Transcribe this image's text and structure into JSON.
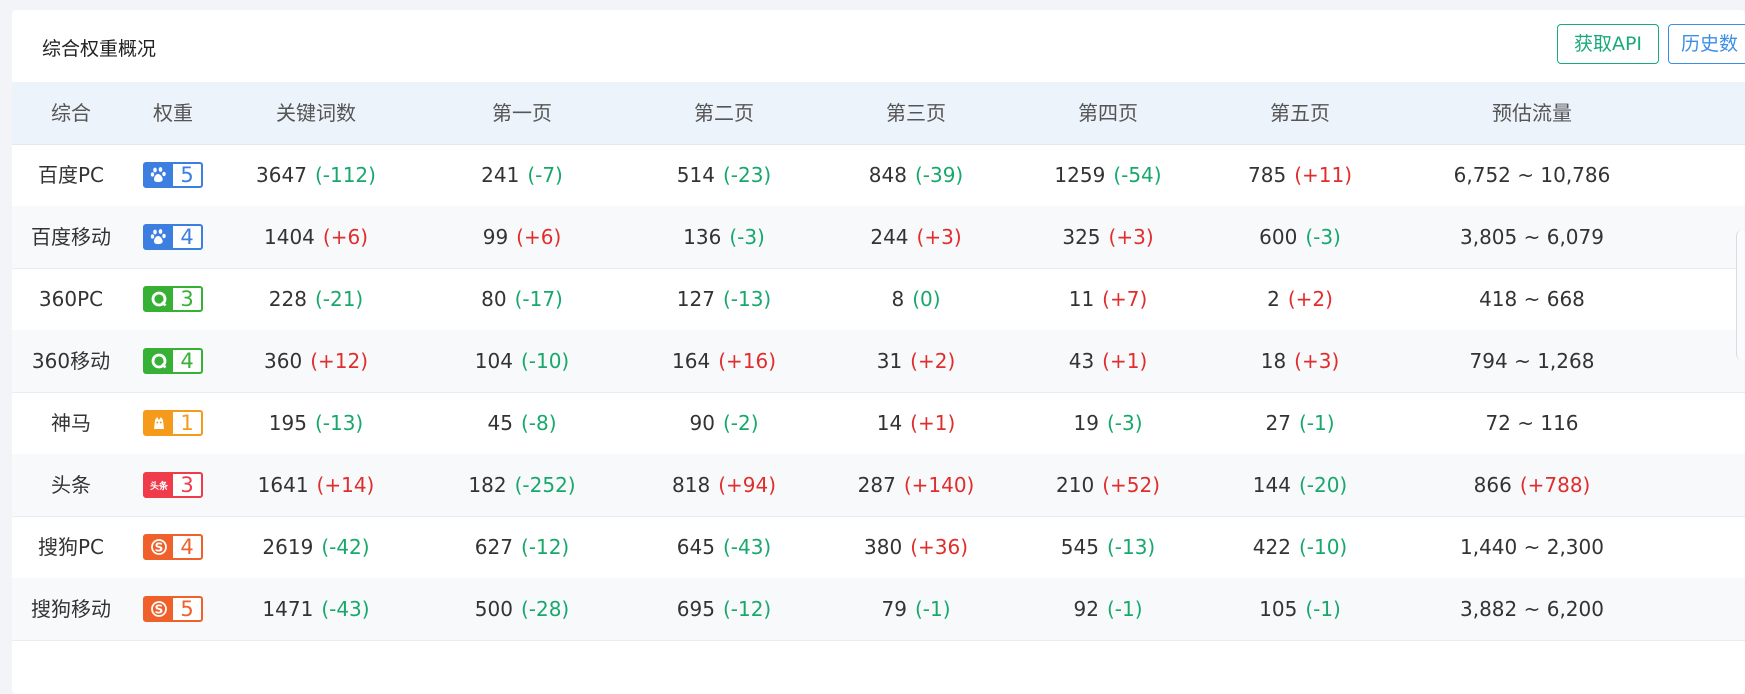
{
  "title": "综合权重概况",
  "buttons": {
    "api": "获取API",
    "history": "历史数"
  },
  "headers": [
    "综合",
    "权重",
    "关键词数",
    "第一页",
    "第二页",
    "第三页",
    "第四页",
    "第五页",
    "预估流量"
  ],
  "colors": {
    "up": "#e02d2d",
    "down": "#18a86c",
    "api_button": "#19a97b",
    "history_button": "#3c8ee8",
    "header_bg": "#edf3fb"
  },
  "rows": [
    {
      "name": "百度PC",
      "icon": "baidu-icon",
      "icon_color": "#3d7fe0",
      "weight": "5",
      "kw": [
        "3647",
        "(-112)"
      ],
      "p1": [
        "241",
        "(-7)"
      ],
      "p2": [
        "514",
        "(-23)"
      ],
      "p3": [
        "848",
        "(-39)"
      ],
      "p4": [
        "1259",
        "(-54)"
      ],
      "p5": [
        "785",
        "(+11)"
      ],
      "flow": [
        "6,752 ~ 10,786",
        ""
      ]
    },
    {
      "name": "百度移动",
      "icon": "baidu-icon",
      "icon_color": "#3d7fe0",
      "weight": "4",
      "kw": [
        "1404",
        "(+6)"
      ],
      "p1": [
        "99",
        "(+6)"
      ],
      "p2": [
        "136",
        "(-3)"
      ],
      "p3": [
        "244",
        "(+3)"
      ],
      "p4": [
        "325",
        "(+3)"
      ],
      "p5": [
        "600",
        "(-3)"
      ],
      "flow": [
        "3,805 ~ 6,079",
        ""
      ]
    },
    {
      "name": "360PC",
      "icon": "360-icon",
      "icon_color": "#36b136",
      "weight": "3",
      "kw": [
        "228",
        "(-21)"
      ],
      "p1": [
        "80",
        "(-17)"
      ],
      "p2": [
        "127",
        "(-13)"
      ],
      "p3": [
        "8",
        "(0)"
      ],
      "p4": [
        "11",
        "(+7)"
      ],
      "p5": [
        "2",
        "(+2)"
      ],
      "flow": [
        "418 ~ 668",
        ""
      ]
    },
    {
      "name": "360移动",
      "icon": "360-icon",
      "icon_color": "#36b136",
      "weight": "4",
      "kw": [
        "360",
        "(+12)"
      ],
      "p1": [
        "104",
        "(-10)"
      ],
      "p2": [
        "164",
        "(+16)"
      ],
      "p3": [
        "31",
        "(+2)"
      ],
      "p4": [
        "43",
        "(+1)"
      ],
      "p5": [
        "18",
        "(+3)"
      ],
      "flow": [
        "794 ~ 1,268",
        ""
      ]
    },
    {
      "name": "神马",
      "icon": "shenma-icon",
      "icon_color": "#f59a1b",
      "weight": "1",
      "kw": [
        "195",
        "(-13)"
      ],
      "p1": [
        "45",
        "(-8)"
      ],
      "p2": [
        "90",
        "(-2)"
      ],
      "p3": [
        "14",
        "(+1)"
      ],
      "p4": [
        "19",
        "(-3)"
      ],
      "p5": [
        "27",
        "(-1)"
      ],
      "flow": [
        "72 ~ 116",
        ""
      ]
    },
    {
      "name": "头条",
      "icon": "toutiao-icon",
      "icon_color": "#ef3b4a",
      "weight": "3",
      "kw": [
        "1641",
        "(+14)"
      ],
      "p1": [
        "182",
        "(-252)"
      ],
      "p2": [
        "818",
        "(+94)"
      ],
      "p3": [
        "287",
        "(+140)"
      ],
      "p4": [
        "210",
        "(+52)"
      ],
      "p5": [
        "144",
        "(-20)"
      ],
      "flow": [
        "866",
        "(+788)"
      ]
    },
    {
      "name": "搜狗PC",
      "icon": "sogou-icon",
      "icon_color": "#f0602a",
      "weight": "4",
      "kw": [
        "2619",
        "(-42)"
      ],
      "p1": [
        "627",
        "(-12)"
      ],
      "p2": [
        "645",
        "(-43)"
      ],
      "p3": [
        "380",
        "(+36)"
      ],
      "p4": [
        "545",
        "(-13)"
      ],
      "p5": [
        "422",
        "(-10)"
      ],
      "flow": [
        "1,440 ~ 2,300",
        ""
      ]
    },
    {
      "name": "搜狗移动",
      "icon": "sogou-icon",
      "icon_color": "#f0602a",
      "weight": "5",
      "kw": [
        "1471",
        "(-43)"
      ],
      "p1": [
        "500",
        "(-28)"
      ],
      "p2": [
        "695",
        "(-12)"
      ],
      "p3": [
        "79",
        "(-1)"
      ],
      "p4": [
        "92",
        "(-1)"
      ],
      "p5": [
        "105",
        "(-1)"
      ],
      "flow": [
        "3,882 ~ 6,200",
        ""
      ]
    }
  ]
}
